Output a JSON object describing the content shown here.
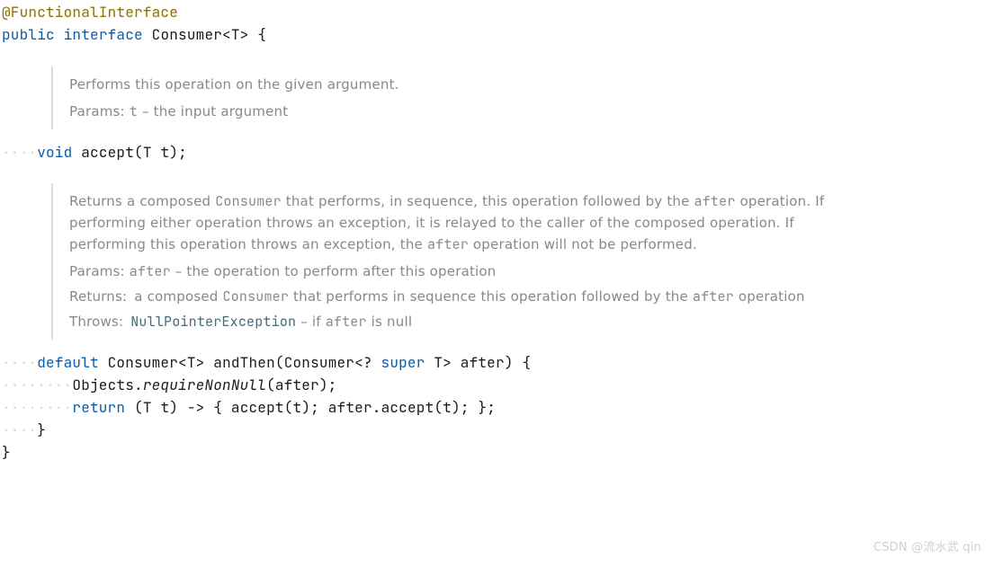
{
  "code": {
    "annotation": "@FunctionalInterface",
    "public": "public",
    "interface_kw": "interface",
    "iface_name": "Consumer",
    "lt": "<",
    "T": "T",
    "gt": ">",
    "open_brace": " {",
    "void_kw": "void",
    "accept": "accept",
    "lp": "(",
    "rp": ")",
    "t_param": " t",
    "semi": ";",
    "default_kw": "default",
    "andThen": "andThen",
    "q_super": "? ",
    "super_kw": "super",
    "after_param": " after",
    "objects": "Objects",
    "requireNonNull": "requireNonNull",
    "after_arg": "after",
    "return_kw": "return",
    "arrow": " -> ",
    "lbody": "{ ",
    "acc_call1": "accept",
    "t_arg": "t",
    "sp": " ",
    "dot": ".",
    "acc_call2": "accept",
    "rbody": " }",
    "close_brace": "}",
    "comma_sp": "; ",
    "cb2": "}"
  },
  "doc1": {
    "desc": "Performs this operation on the given argument.",
    "params_label": "Params: ",
    "params_key": "t",
    "params_txt": " – the input argument"
  },
  "doc2": {
    "desc_p1": "Returns a composed ",
    "desc_c1": "Consumer",
    "desc_p2": " that performs, in sequence, this operation followed by the ",
    "desc_c2": "after",
    "desc_p3": " operation. If performing either operation throws an exception, it is relayed to the caller of the composed operation. If performing this operation throws an exception, the ",
    "desc_c3": "after",
    "desc_p4": " operation will not be performed.",
    "params_label": "Params: ",
    "params_key": "after",
    "params_txt": " – the operation to perform after this operation",
    "returns_label": "Returns: ",
    "returns_p1": "a composed ",
    "returns_c1": "Consumer",
    "returns_p2": " that performs in sequence this operation followed by the ",
    "returns_c2": "after",
    "returns_p3": " operation",
    "throws_label": "Throws: ",
    "throws_ex": "NullPointerException",
    "throws_p1": " – if ",
    "throws_c1": "after",
    "throws_p2": " is null"
  },
  "watermark": "CSDN @流水武 qin"
}
